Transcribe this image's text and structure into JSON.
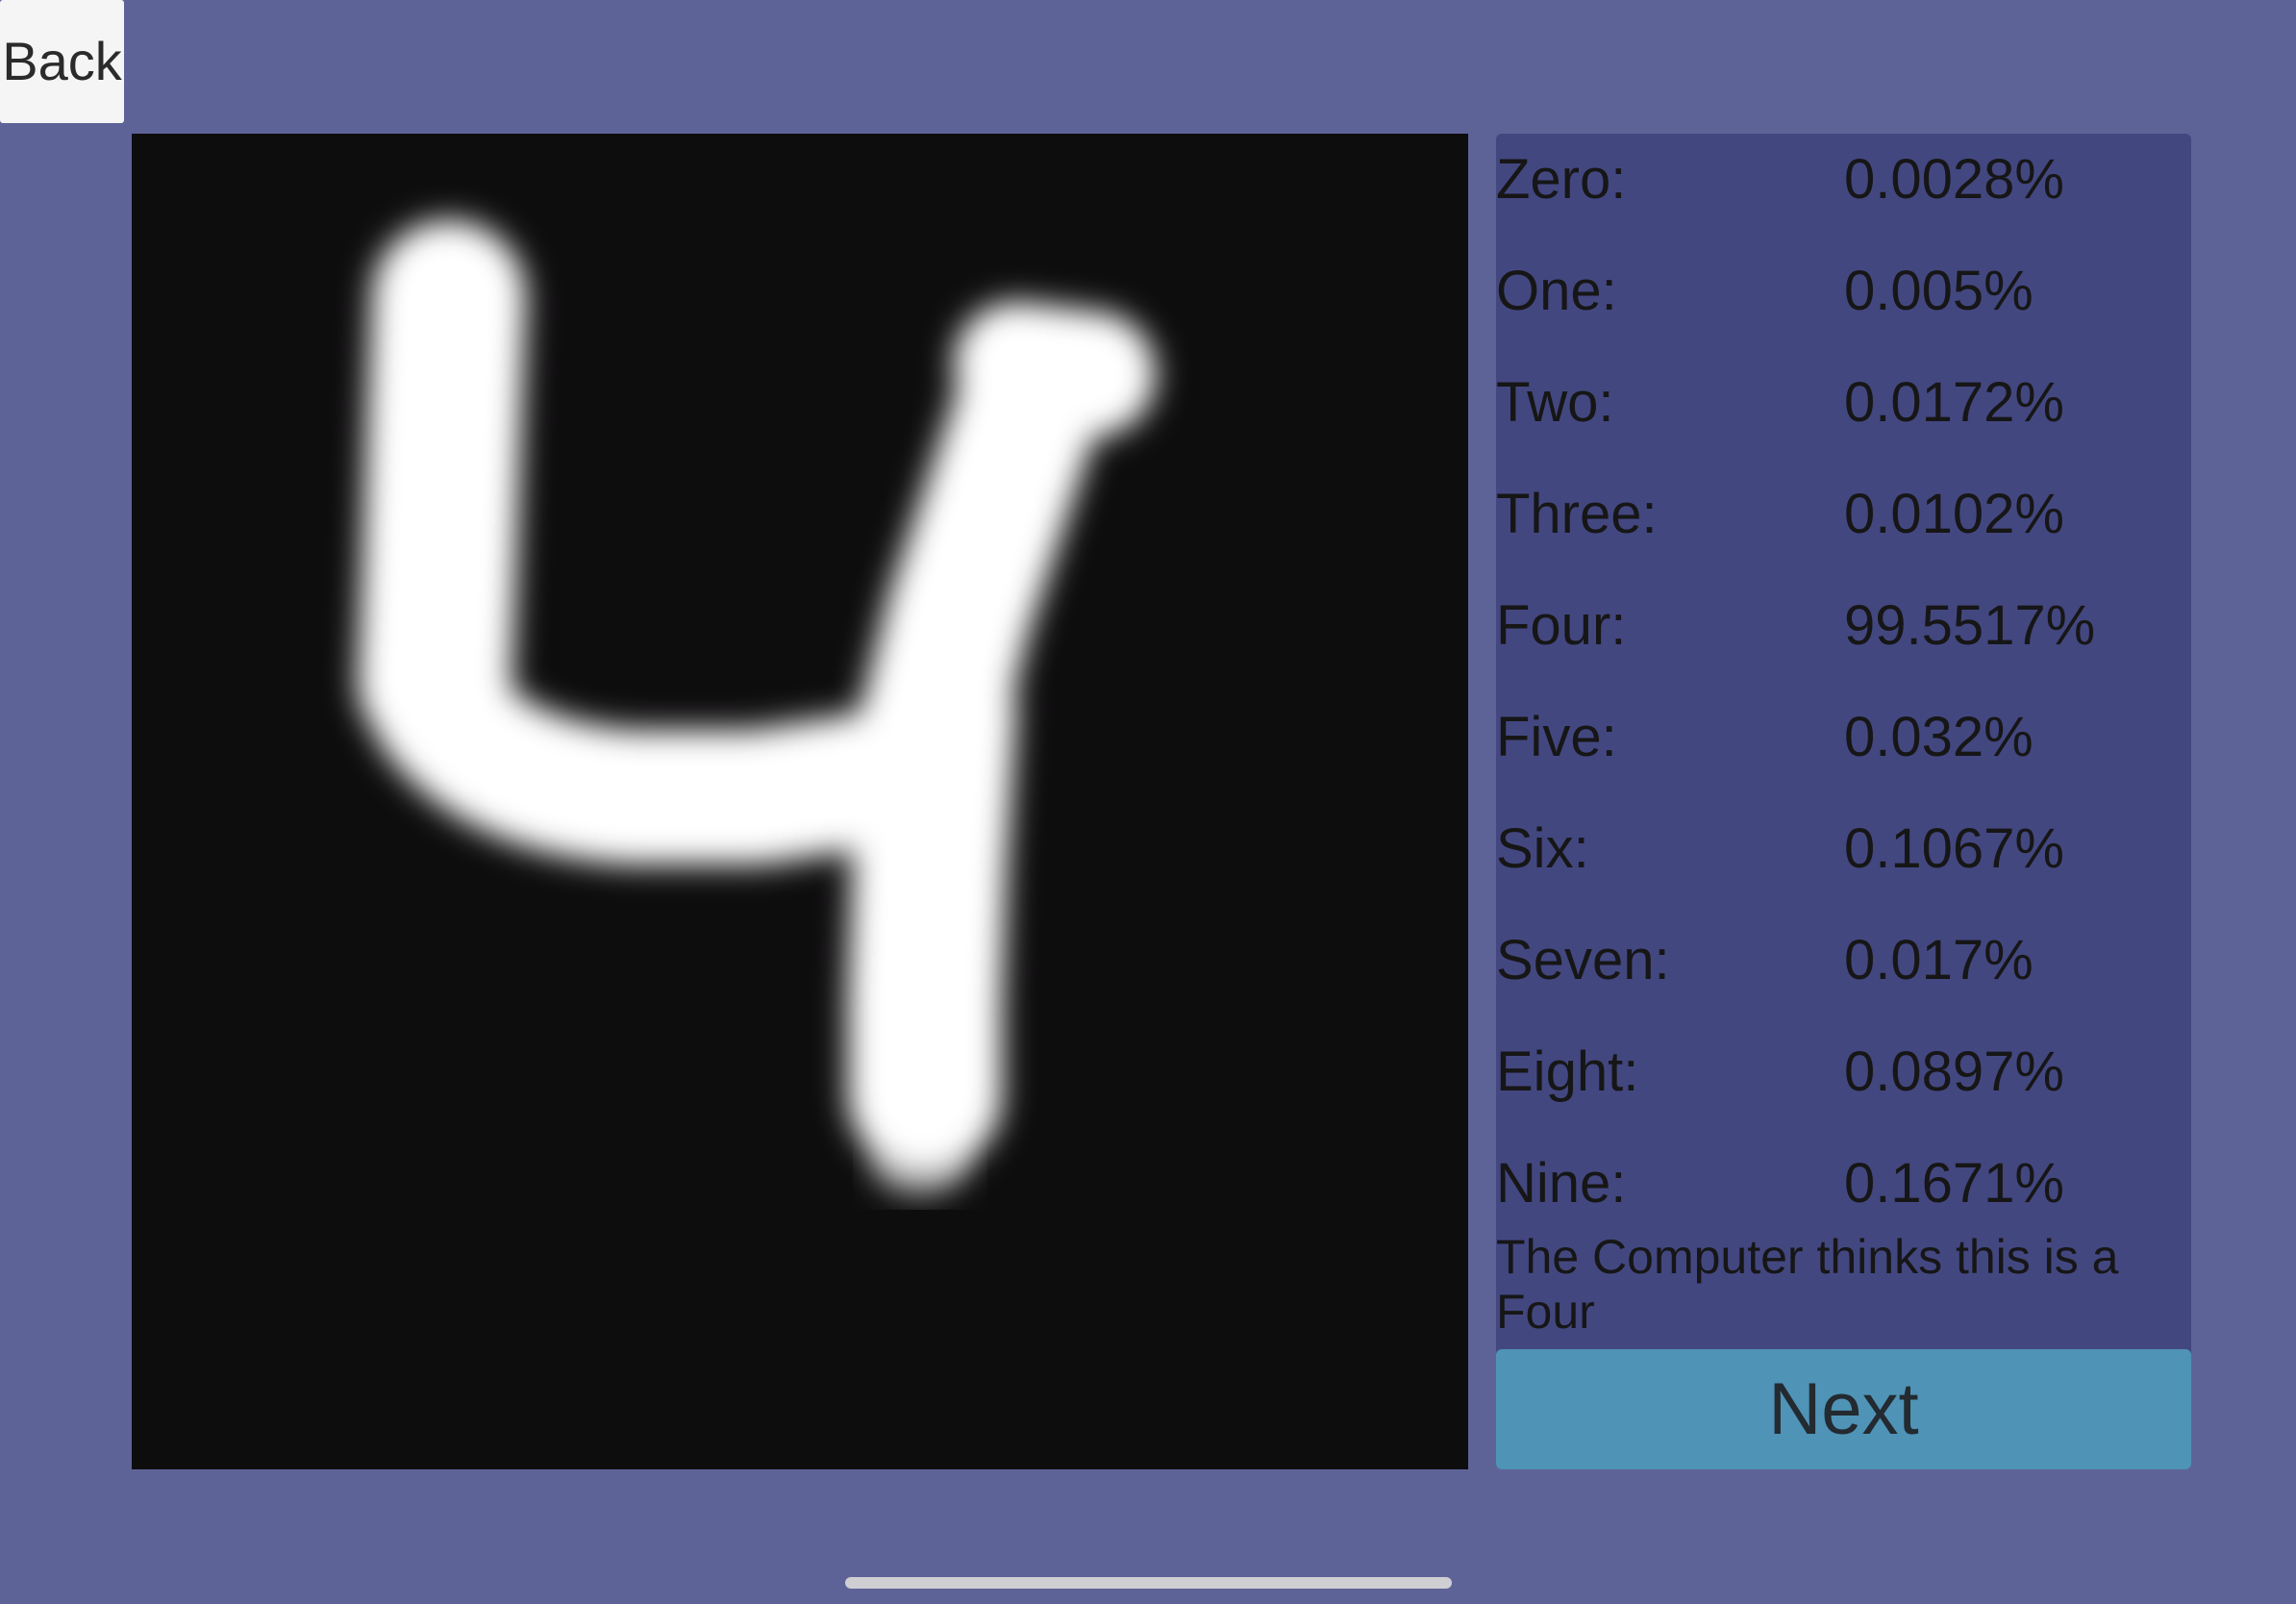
{
  "toolbar": {
    "back_label": "Back"
  },
  "digit_image": {
    "icon": "handwritten-digit-four-image"
  },
  "results": {
    "rows": [
      {
        "label": "Zero:",
        "value": "0.0028%"
      },
      {
        "label": "One:",
        "value": "0.005%"
      },
      {
        "label": "Two:",
        "value": "0.0172%"
      },
      {
        "label": "Three:",
        "value": "0.0102%"
      },
      {
        "label": "Four:",
        "value": "99.5517%"
      },
      {
        "label": "Five:",
        "value": "0.032%"
      },
      {
        "label": "Six:",
        "value": "0.1067%"
      },
      {
        "label": "Seven:",
        "value": "0.017%"
      },
      {
        "label": "Eight:",
        "value": "0.0897%"
      },
      {
        "label": "Nine:",
        "value": "0.1671%"
      }
    ],
    "verdict": "The Computer thinks this is a Four"
  },
  "actions": {
    "next_label": "Next"
  },
  "colors": {
    "background": "#5e6397",
    "panel": "#434780",
    "canvas": "#0e0d0e",
    "next_button": "#4f93b6",
    "back_button": "#f5f5f5"
  }
}
